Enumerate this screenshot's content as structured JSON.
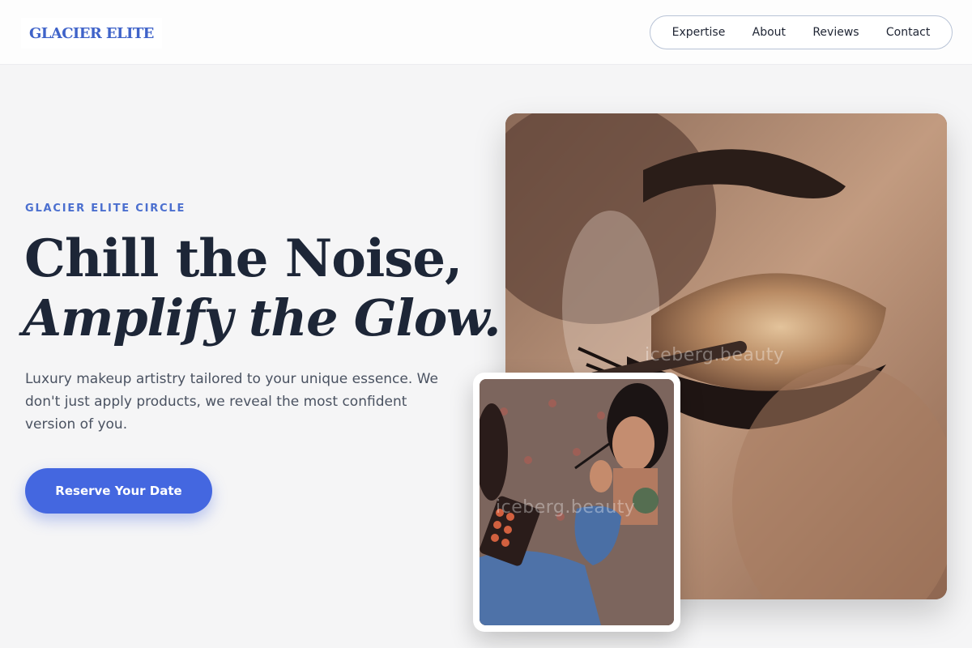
{
  "header": {
    "logo": "GLACIER ELITE",
    "nav": [
      "Expertise",
      "About",
      "Reviews",
      "Contact"
    ]
  },
  "hero": {
    "eyebrow": "GLACIER ELITE CIRCLE",
    "headline_line1": "Chill the Noise,",
    "headline_line2": "Amplify the Glow.",
    "description": "Luxury makeup artistry tailored to your unique essence. We don't just apply products, we reveal the most confident version of you.",
    "cta": "Reserve Your Date"
  },
  "images": {
    "main_watermark": "iceberg.beauty",
    "inset_watermark": "iceberg.beauty"
  },
  "colors": {
    "accent": "#4467e0",
    "logo": "#3f63c9",
    "heading": "#1d2637"
  }
}
